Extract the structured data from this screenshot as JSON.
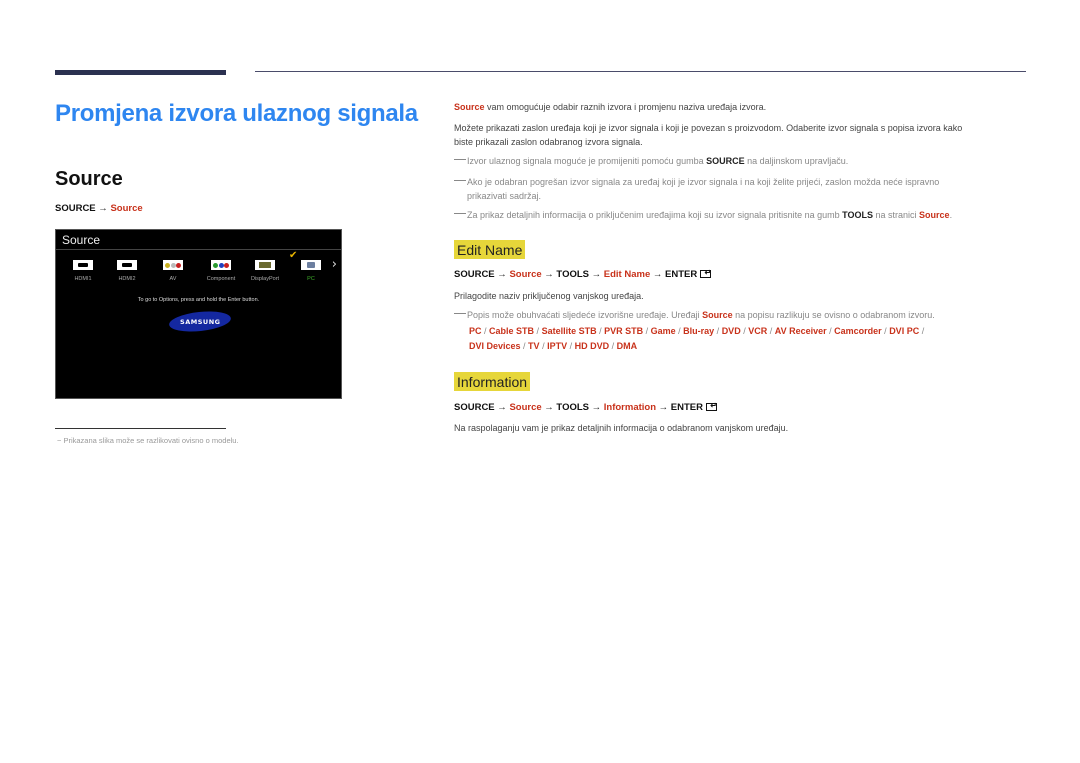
{
  "page": {
    "title": "Promjena izvora ulaznog signala",
    "section_title": "Source",
    "path": {
      "prefix": "SOURCE → ",
      "target": "Source"
    }
  },
  "tv_screen": {
    "title": "Source",
    "sources": [
      {
        "label": "HDMI1",
        "icon": "hdmi-port-icon",
        "selected": false
      },
      {
        "label": "HDMI2",
        "icon": "hdmi-port-icon",
        "selected": false
      },
      {
        "label": "AV",
        "icon": "av-port-icon",
        "selected": false
      },
      {
        "label": "Component",
        "icon": "component-port-icon",
        "selected": false
      },
      {
        "label": "DisplayPort",
        "icon": "displayport-icon",
        "selected": false
      },
      {
        "label": "PC",
        "icon": "vga-port-icon",
        "selected": true
      }
    ],
    "next_arrow": "›",
    "check_mark": "✔",
    "hint": "To go to Options, press and hold the Enter button.",
    "logo": "SAMSUNG",
    "colors": {
      "selected_label": "#3fae2a",
      "check": "#e7b400",
      "logo_bg": "#1428a0"
    }
  },
  "footnote": "−  Prikazana slika može se razlikovati ovisno o modelu.",
  "intro": {
    "line1_key": "Source",
    "line1_rest": " vam omogućuje odabir raznih izvora i promjenu naziva uređaja izvora.",
    "line2": "Možete prikazati zaslon uređaja koji je izvor signala i koji je povezan s proizvodom. Odaberite izvor signala s popisa izvora kako",
    "line3": "biste prikazali zaslon odabranog izvora signala."
  },
  "notes": {
    "n1_a": "Izvor ulaznog signala moguće je promijeniti pomoću gumba ",
    "n1_b": "SOURCE",
    "n1_c": " na daljinskom upravljaču.",
    "n2_a": "Ako je odabran pogrešan izvor signala za uređaj koji je izvor signala i na koji želite prijeći, zaslon možda neće ispravno",
    "n2_b": "prikazivati sadržaj.",
    "n3_a": "Za prikaz detaljnih informacija o priključenim uređajima koji su izvor signala pritisnite na gumb ",
    "n3_b": "TOOLS",
    "n3_c": " na stranici ",
    "n3_d": "Source",
    "n3_e": "."
  },
  "edit_name": {
    "heading": "Edit Name",
    "path": [
      "SOURCE → ",
      "Source",
      " → TOOLS → ",
      "Edit Name",
      " → ENTER"
    ],
    "description": "Prilagodite naziv priključenog vanjskog uređaja.",
    "note_a": "Popis može obuhvaćati sljedeće izvorišne uređaje. Uređaji ",
    "note_b": "Source",
    "note_c": " na popisu razlikuju se ovisno o odabranom izvoru.",
    "devices_line1": [
      "PC",
      "Cable STB",
      "Satellite STB",
      "PVR STB",
      "Game",
      "Blu-ray",
      "DVD",
      "VCR",
      "AV Receiver",
      "Camcorder",
      "DVI PC"
    ],
    "devices_line2": [
      "DVI Devices",
      "TV",
      "IPTV",
      "HD DVD",
      "DMA"
    ],
    "separator": " / "
  },
  "information": {
    "heading": "Information",
    "path": [
      "SOURCE → ",
      "Source",
      " → TOOLS → ",
      "Information",
      " → ENTER"
    ],
    "description": "Na raspolaganju vam je prikaz detaljnih informacija o odabranom vanjskom uređaju."
  },
  "colors": {
    "title_blue": "#2e86f0",
    "accent_red": "#c8321b",
    "heading_highlight": "#e6d63a",
    "rule_dark": "#2b3150"
  }
}
